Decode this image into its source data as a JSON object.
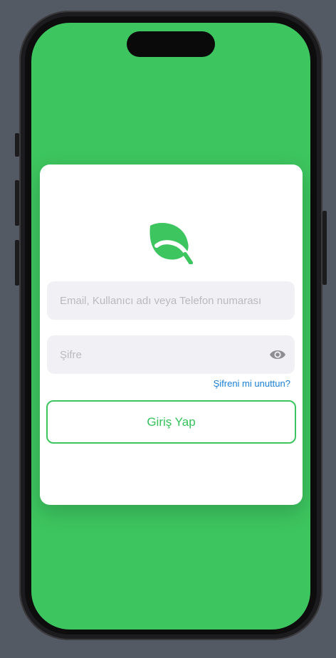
{
  "colors": {
    "background": "#545a63",
    "screen": "#3dc55f",
    "accent": "#3dc55f",
    "link": "#1a7fd6",
    "field_bg": "#f1f1f5",
    "placeholder": "#b9b9c0"
  },
  "login": {
    "logo_icon": "leaf-icon",
    "identifier_field": {
      "placeholder": "Email, Kullanıcı adı veya Telefon numarası",
      "value": ""
    },
    "password_field": {
      "placeholder": "Şifre",
      "value": "",
      "toggle_icon": "eye-icon"
    },
    "forgot_password_link": "Şifreni mi unuttun?",
    "submit_label": "Giriş Yap"
  }
}
